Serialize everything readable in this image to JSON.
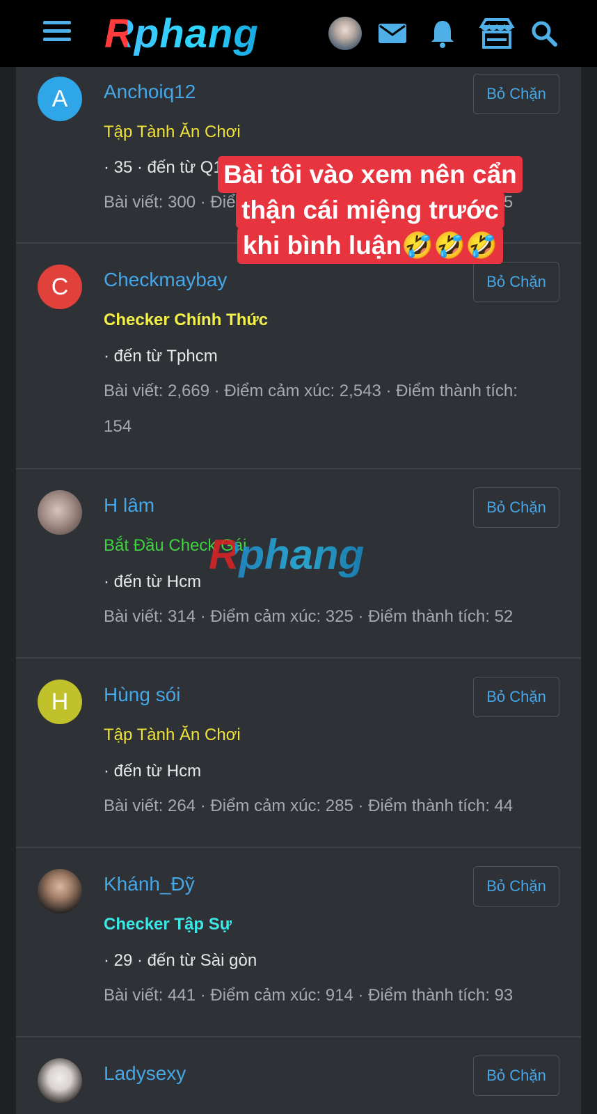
{
  "header": {
    "logo_text": "Rphang",
    "icons": [
      "menu-icon",
      "avatar",
      "mail-icon",
      "bell-icon",
      "store-icon",
      "search-icon"
    ]
  },
  "members": [
    {
      "initial": "A",
      "avatar_color": "#2ea6e8",
      "name": "Anchoiq12",
      "title": "Tập Tành Ăn Chơi",
      "title_color": "#f0e23a",
      "title_bold": false,
      "location": "· 35 · đến từ Q1",
      "stats": "Bài viết: 300 · Điểm cảm xúc: 335 · Điểm thành tích: 35",
      "unblock_label": "Bỏ Chặn"
    },
    {
      "initial": "C",
      "avatar_color": "#e0413b",
      "name": "Checkmaybay",
      "title": "Checker Chính Thức",
      "title_color": "#f3f04a",
      "title_bold": true,
      "location": "· đến từ Tphcm",
      "stats": "Bài viết: 2,669 · Điểm cảm xúc: 2,543 · Điểm thành tích: 154",
      "unblock_label": "Bỏ Chặn"
    },
    {
      "initial": "",
      "avatar_color": "#9b8a84",
      "name": "H lâm",
      "title": "Bắt Đầu Check Gái",
      "title_color": "#3fd33f",
      "title_bold": false,
      "location": "· đến từ Hcm",
      "stats": "Bài viết: 314 · Điểm cảm xúc: 325 · Điểm thành tích: 52",
      "unblock_label": "Bỏ Chặn"
    },
    {
      "initial": "H",
      "avatar_color": "#c1c12b",
      "name": "Hùng sói",
      "title": "Tập Tành Ăn Chơi",
      "title_color": "#f0e23a",
      "title_bold": false,
      "location": "· đến từ Hcm",
      "stats": "Bài viết: 264 · Điểm cảm xúc: 285 · Điểm thành tích: 44",
      "unblock_label": "Bỏ Chặn"
    },
    {
      "initial": "",
      "avatar_color": "#8a7466",
      "name": "Khánh_Đỹ",
      "title": "Checker Tập Sự",
      "title_color": "#3ee6e6",
      "title_bold": true,
      "location": "· 29 · đến từ Sài gòn",
      "stats": "Bài viết: 441 · Điểm cảm xúc: 914 · Điểm thành tích: 93",
      "unblock_label": "Bỏ Chặn"
    },
    {
      "initial": "",
      "avatar_color": "#d7d2cf",
      "name": "Ladysexy",
      "title": "",
      "title_color": "#f0e23a",
      "title_bold": false,
      "location": "",
      "stats": "",
      "unblock_label": "Bỏ Chặn"
    }
  ],
  "overlay": {
    "lines": [
      "Bài tôi vào xem nên cẩn",
      "thận cái miệng trước",
      "khi bình luận🤣🤣🤣"
    ]
  },
  "watermark_text": "Rphang"
}
